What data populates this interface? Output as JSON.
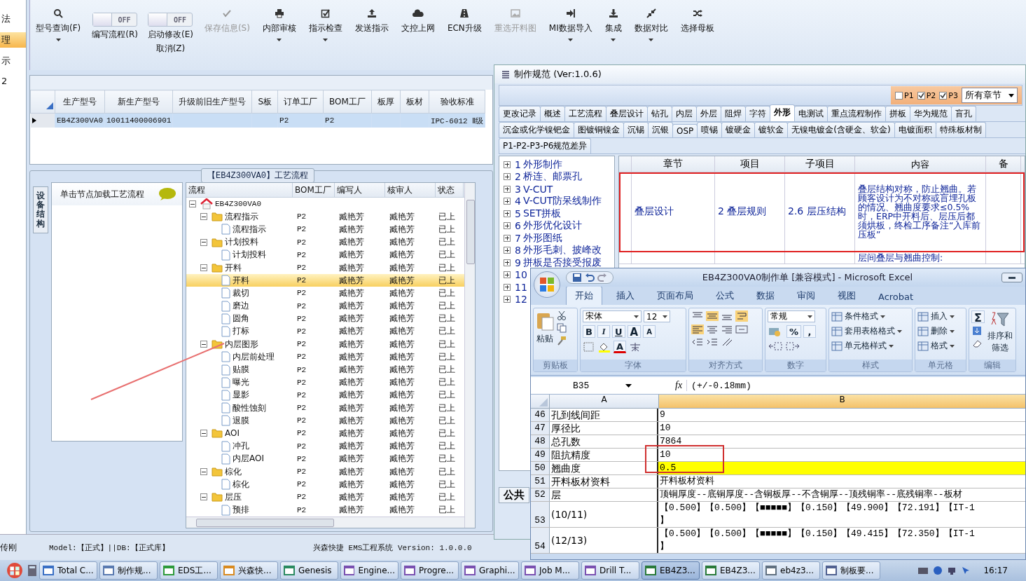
{
  "left_strip": {
    "items": [
      {
        "label": "法",
        "selected": false
      },
      {
        "label": "理",
        "selected": true
      },
      {
        "label": "示",
        "selected": false
      },
      {
        "label": "2",
        "selected": false
      }
    ]
  },
  "toolbar": {
    "buttons": [
      {
        "kind": "button",
        "label": "型号查询(F)",
        "dropdown": true,
        "disabled": false
      },
      {
        "kind": "toggle",
        "label": "编写流程(R)",
        "state": "OFF",
        "on": false
      },
      {
        "kind": "toggle",
        "label": "启动修改(E)",
        "sublabel": "取消(Z)",
        "state": "OFF",
        "on": false
      },
      {
        "kind": "button",
        "label": "保存信息(S)",
        "dropdown": false,
        "disabled": true
      },
      {
        "kind": "button",
        "label": "内部审核",
        "dropdown": true,
        "disabled": false
      },
      {
        "kind": "button",
        "label": "指示检查",
        "dropdown": true,
        "disabled": false
      },
      {
        "kind": "button",
        "label": "发送指示",
        "dropdown": false,
        "disabled": false
      },
      {
        "kind": "button",
        "label": "文控上网",
        "dropdown": false,
        "disabled": false
      },
      {
        "kind": "button",
        "label": "ECN升级",
        "dropdown": false,
        "disabled": false
      },
      {
        "kind": "button",
        "label": "重选开料图",
        "dropdown": false,
        "disabled": true
      },
      {
        "kind": "button",
        "label": "MI数据导入",
        "dropdown": true,
        "disabled": false
      },
      {
        "kind": "button",
        "label": "集成",
        "dropdown": true,
        "disabled": false
      },
      {
        "kind": "button",
        "label": "数据对比",
        "dropdown": true,
        "disabled": false
      },
      {
        "kind": "button",
        "label": "选择母板",
        "dropdown": false,
        "disabled": false
      }
    ]
  },
  "product_grid": {
    "columns": [
      "生产型号",
      "新生产型号",
      "升级前旧生产型号",
      "S板",
      "订单工厂",
      "BOM工厂",
      "板厚",
      "板材",
      "验收标准"
    ],
    "rows": [
      {
        "selected": true,
        "cells": [
          "EB4Z300VA0",
          "10011400006901",
          "",
          "",
          "P2",
          "P2",
          "",
          "",
          "IPC-6012 Ⅱ级"
        ]
      }
    ]
  },
  "process_panel": {
    "title": "【EB4Z300VA0】工艺流程",
    "side_tab": "设备结构",
    "hint": "单击节点加载工艺流程",
    "columns": [
      "流程",
      "BOM工厂",
      "编写人",
      "核审人",
      "状态"
    ],
    "tree": [
      {
        "label": "EB4Z300VA0",
        "kind": "root",
        "expanded": true,
        "children": [
          {
            "label": "流程指示",
            "kind": "folder",
            "expanded": true,
            "bom": "P2",
            "writer": "臧艳芳",
            "reviewer": "臧艳芳",
            "status": "已上",
            "children": [
              {
                "label": "流程指示",
                "kind": "step",
                "selected": false,
                "bom": "P2",
                "writer": "臧艳芳",
                "reviewer": "臧艳芳",
                "status": "已上"
              }
            ]
          },
          {
            "label": "计划投料",
            "kind": "folder",
            "expanded": true,
            "bom": "P2",
            "writer": "臧艳芳",
            "reviewer": "臧艳芳",
            "status": "已上",
            "children": [
              {
                "label": "计划投料",
                "kind": "step",
                "selected": false,
                "bom": "P2",
                "writer": "臧艳芳",
                "reviewer": "臧艳芳",
                "status": "已上"
              }
            ]
          },
          {
            "label": "开料",
            "kind": "folder",
            "expanded": true,
            "bom": "P2",
            "writer": "臧艳芳",
            "reviewer": "臧艳芳",
            "status": "已上",
            "children": [
              {
                "label": "开料",
                "kind": "step",
                "selected": true,
                "bom": "P2",
                "writer": "臧艳芳",
                "reviewer": "臧艳芳",
                "status": "已上"
              },
              {
                "label": "裁切",
                "kind": "step",
                "selected": false,
                "bom": "P2",
                "writer": "臧艳芳",
                "reviewer": "臧艳芳",
                "status": "已上"
              },
              {
                "label": "磨边",
                "kind": "step",
                "selected": false,
                "bom": "P2",
                "writer": "臧艳芳",
                "reviewer": "臧艳芳",
                "status": "已上"
              },
              {
                "label": "圆角",
                "kind": "step",
                "selected": false,
                "bom": "P2",
                "writer": "臧艳芳",
                "reviewer": "臧艳芳",
                "status": "已上"
              },
              {
                "label": "打标",
                "kind": "step",
                "selected": false,
                "bom": "P2",
                "writer": "臧艳芳",
                "reviewer": "臧艳芳",
                "status": "已上"
              }
            ]
          },
          {
            "label": "内层图形",
            "kind": "folder",
            "expanded": true,
            "bom": "P2",
            "writer": "臧艳芳",
            "reviewer": "臧艳芳",
            "status": "已上",
            "children": [
              {
                "label": "内层前处理",
                "kind": "step",
                "selected": false,
                "bom": "P2",
                "writer": "臧艳芳",
                "reviewer": "臧艳芳",
                "status": "已上"
              },
              {
                "label": "贴膜",
                "kind": "step",
                "selected": false,
                "bom": "P2",
                "writer": "臧艳芳",
                "reviewer": "臧艳芳",
                "status": "已上"
              },
              {
                "label": "曝光",
                "kind": "step",
                "selected": false,
                "bom": "P2",
                "writer": "臧艳芳",
                "reviewer": "臧艳芳",
                "status": "已上"
              },
              {
                "label": "显影",
                "kind": "step",
                "selected": false,
                "bom": "P2",
                "writer": "臧艳芳",
                "reviewer": "臧艳芳",
                "status": "已上"
              },
              {
                "label": "酸性蚀刻",
                "kind": "step",
                "selected": false,
                "bom": "P2",
                "writer": "臧艳芳",
                "reviewer": "臧艳芳",
                "status": "已上"
              },
              {
                "label": "退膜",
                "kind": "step",
                "selected": false,
                "bom": "P2",
                "writer": "臧艳芳",
                "reviewer": "臧艳芳",
                "status": "已上"
              }
            ]
          },
          {
            "label": "AOI",
            "kind": "folder",
            "expanded": true,
            "bom": "P2",
            "writer": "臧艳芳",
            "reviewer": "臧艳芳",
            "status": "已上",
            "children": [
              {
                "label": "冲孔",
                "kind": "step",
                "selected": false,
                "bom": "P2",
                "writer": "臧艳芳",
                "reviewer": "臧艳芳",
                "status": "已上"
              },
              {
                "label": "内层AOI",
                "kind": "step",
                "selected": false,
                "bom": "P2",
                "writer": "臧艳芳",
                "reviewer": "臧艳芳",
                "status": "已上"
              }
            ]
          },
          {
            "label": "棕化",
            "kind": "folder",
            "expanded": true,
            "bom": "P2",
            "writer": "臧艳芳",
            "reviewer": "臧艳芳",
            "status": "已上",
            "children": [
              {
                "label": "棕化",
                "kind": "step",
                "selected": false,
                "bom": "P2",
                "writer": "臧艳芳",
                "reviewer": "臧艳芳",
                "status": "已上"
              }
            ]
          },
          {
            "label": "层压",
            "kind": "folder",
            "expanded": true,
            "bom": "P2",
            "writer": "臧艳芳",
            "reviewer": "臧艳芳",
            "status": "已上",
            "children": [
              {
                "label": "预排",
                "kind": "step",
                "selected": false,
                "bom": "P2",
                "writer": "臧艳芳",
                "reviewer": "臧艳芳",
                "status": "已上"
              }
            ]
          }
        ]
      }
    ]
  },
  "status_bar": {
    "user": "传刚",
    "model": "Model:【正式】||DB:【正式库】",
    "app": "兴森快捷 EMS工程系统 Version: 1.0.0.0"
  },
  "spec_window": {
    "title": "制作规范 (Ver:1.0.6)",
    "filters": [
      {
        "label": "P1",
        "checked": false
      },
      {
        "label": "P2",
        "checked": true
      },
      {
        "label": "P3",
        "checked": true
      }
    ],
    "chapter_select": "所有章节",
    "tab_rows": [
      [
        {
          "label": "更改记录",
          "selected": false
        },
        {
          "label": "概述",
          "selected": false
        },
        {
          "label": "工艺流程",
          "selected": false
        },
        {
          "label": "叠层设计",
          "selected": false
        },
        {
          "label": "钻孔",
          "selected": false
        },
        {
          "label": "内层",
          "selected": false
        },
        {
          "label": "外层",
          "selected": false
        },
        {
          "label": "阻焊",
          "selected": false
        },
        {
          "label": "字符",
          "selected": false
        },
        {
          "label": "外形",
          "selected": true
        },
        {
          "label": "电测试",
          "selected": false
        },
        {
          "label": "重点流程制作",
          "selected": false
        },
        {
          "label": "拼板",
          "selected": false
        },
        {
          "label": "华为规范",
          "selected": false
        },
        {
          "label": "盲孔",
          "selected": false
        }
      ],
      [
        {
          "label": "沉金或化学镍钯金",
          "selected": false
        },
        {
          "label": "图镀铜镍金",
          "selected": false
        },
        {
          "label": "沉锡",
          "selected": false
        },
        {
          "label": "沉银",
          "selected": false
        },
        {
          "label": "OSP",
          "selected": false
        },
        {
          "label": "喷锡",
          "selected": false
        },
        {
          "label": "镀硬金",
          "selected": false
        },
        {
          "label": "镀软金",
          "selected": false
        },
        {
          "label": "无镍电镀金(含硬金、软金)",
          "selected": false
        },
        {
          "label": "电镀面积",
          "selected": false
        },
        {
          "label": "特殊板材制",
          "selected": false
        }
      ],
      [
        {
          "label": "P1-P2-P3-P6规范差异",
          "selected": false
        }
      ]
    ],
    "sections": [
      {
        "num": "1",
        "label": "外形制作"
      },
      {
        "num": "2",
        "label": "桥连、邮票孔"
      },
      {
        "num": "3",
        "label": "V-CUT"
      },
      {
        "num": "4",
        "label": "V-CUT防呆线制作"
      },
      {
        "num": "5",
        "label": "SET拼板"
      },
      {
        "num": "6",
        "label": "外形优化设计"
      },
      {
        "num": "7",
        "label": "外形图纸"
      },
      {
        "num": "8",
        "label": "外形毛刺、披峰改"
      },
      {
        "num": "9",
        "label": "拼板是否接受报废"
      },
      {
        "num": "10"
      },
      {
        "num": "11"
      },
      {
        "num": "12"
      }
    ],
    "columns": [
      "章节",
      "项目",
      "子项目",
      "内容",
      "备"
    ],
    "rows": [
      {
        "cells": [
          "叠层设计",
          "2 叠层规则",
          "2.6 层压结构",
          "叠层结构对称，防止翘曲。若顾客设计为不对称或盲埋孔板的情况、翘曲度要求≤0.5%时，ERP中开料后、层压后都须烘板，终检工序备注“入库前压板”",
          ""
        ]
      },
      {
        "cells": [
          "",
          "",
          "",
          "层间叠层与翘曲控制:",
          ""
        ]
      }
    ],
    "footer_tab": "公共"
  },
  "excel": {
    "title": "EB4Z300VA0制作单  [兼容模式] - Microsoft Excel",
    "tabs": [
      {
        "label": "开始",
        "selected": true
      },
      {
        "label": "插入",
        "selected": false
      },
      {
        "label": "页面布局",
        "selected": false
      },
      {
        "label": "公式",
        "selected": false
      },
      {
        "label": "数据",
        "selected": false
      },
      {
        "label": "审阅",
        "selected": false
      },
      {
        "label": "视图",
        "selected": false
      },
      {
        "label": "Acrobat",
        "selected": false
      }
    ],
    "ribbon": {
      "paste": "粘贴",
      "font_name": "宋体",
      "font_size": "12",
      "font_buttons": [
        "B",
        "I",
        "U"
      ],
      "grow_shrink": [
        "A",
        "A"
      ],
      "font_color": "A",
      "number_format": "常规",
      "number_buttons": [
        "%",
        ","
      ],
      "styles": [
        "条件格式",
        "套用表格格式",
        "单元格样式"
      ],
      "cells": [
        "插入",
        "删除",
        "格式"
      ],
      "sum": "Σ",
      "sort": "排序和筛选",
      "groups": [
        "剪贴板",
        "字体",
        "对齐方式",
        "数字",
        "样式",
        "单元格",
        "编辑"
      ]
    },
    "name_box": "B35",
    "fx": "fx",
    "formula": "(+/-0.18mm)",
    "columns": [
      "A",
      "B"
    ],
    "rows": [
      {
        "num": "46",
        "a": "孔到线间距",
        "b": [
          "9"
        ],
        "highlighted": false
      },
      {
        "num": "47",
        "a": "厚径比",
        "b": [
          "10"
        ],
        "highlighted": false
      },
      {
        "num": "48",
        "a": "总孔数",
        "b": [
          "7864"
        ],
        "highlighted": false
      },
      {
        "num": "49",
        "a": "阻抗精度",
        "b": [
          "10"
        ],
        "highlighted": false
      },
      {
        "num": "50",
        "a": "翘曲度",
        "b": [
          "0.5"
        ],
        "highlighted": true
      },
      {
        "num": "51",
        "a": "开料板材资料",
        "b": [
          "开料板材资料"
        ],
        "highlighted": false
      },
      {
        "num": "52",
        "a": "层",
        "b": [
          "顶铜厚度--底铜厚度--含铜板厚--不含铜厚--顶残铜率--底残铜率--板材"
        ],
        "highlighted": false
      },
      {
        "num": "53",
        "a": "(10/11)",
        "b": [
          "【0.500】【0.500】【■■■■■】【0.150】【49.900】【72.191】【IT-1",
          "】"
        ],
        "highlighted": false
      },
      {
        "num": "54",
        "a": "(12/13)",
        "b": [
          "【0.500】【0.500】【■■■■■】【0.150】【49.415】【72.350】【IT-1",
          "】"
        ],
        "highlighted": false
      }
    ]
  },
  "taskbar": {
    "items": [
      {
        "label": "Total C...",
        "active": false
      },
      {
        "label": "制作规...",
        "active": false
      },
      {
        "label": "EDS工...",
        "active": false
      },
      {
        "label": "兴森快...",
        "active": false
      },
      {
        "label": "Genesis",
        "active": false
      },
      {
        "label": "Engine...",
        "active": false
      },
      {
        "label": "Progre...",
        "active": false
      },
      {
        "label": "Graphi...",
        "active": false
      },
      {
        "label": "Job M...",
        "active": false
      },
      {
        "label": "Drill T...",
        "active": false
      },
      {
        "label": "EB4Z3...",
        "active": true
      },
      {
        "label": "EB4Z3...",
        "active": false
      },
      {
        "label": "eb4z3...",
        "active": false
      },
      {
        "label": "制板要...",
        "active": false
      }
    ],
    "clock": "16:17"
  }
}
